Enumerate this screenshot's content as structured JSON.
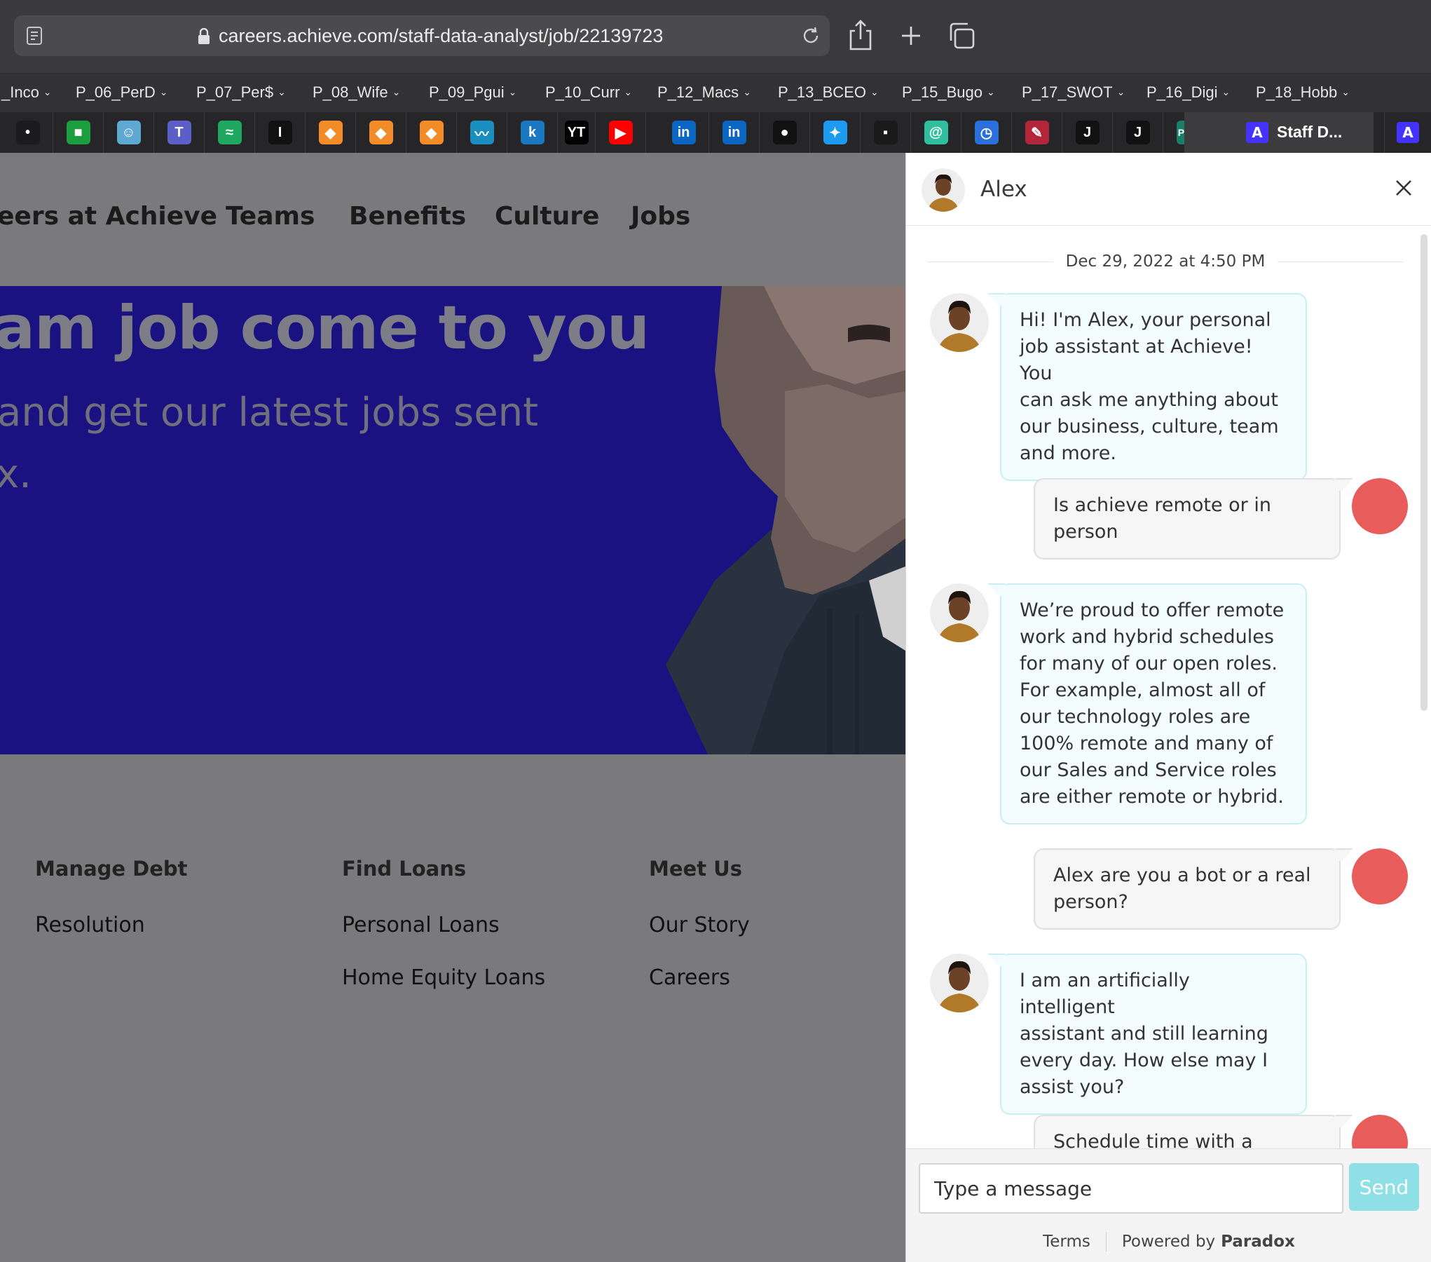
{
  "browser": {
    "url": "careers.achieve.com/staff-data-analyst/job/22139723",
    "bookmarks": [
      {
        "label": "_Inco"
      },
      {
        "label": "P_06_PerD"
      },
      {
        "label": "P_07_Per$"
      },
      {
        "label": "P_08_Wife"
      },
      {
        "label": "P_09_Pgui"
      },
      {
        "label": "P_10_Curr"
      },
      {
        "label": "P_12_Macs"
      },
      {
        "label": "P_13_BCEO"
      },
      {
        "label": "P_15_Bugo"
      },
      {
        "label": "P_17_SWOT"
      },
      {
        "label": "P_16_Digi"
      },
      {
        "label": "P_18_Hobb"
      }
    ],
    "pinned_tabs": [
      {
        "icon": "dots-app-icon",
        "glyph": "•",
        "color": "#1c1c1e"
      },
      {
        "icon": "green-square-icon",
        "glyph": "■",
        "color": "#1b9e3e"
      },
      {
        "icon": "reddit-icon",
        "glyph": "☺",
        "color": "#5fa8d3"
      },
      {
        "icon": "teams-icon",
        "glyph": "T",
        "color": "#5b5fc7"
      },
      {
        "icon": "zapier-like-icon",
        "glyph": "≈",
        "color": "#1fa85f"
      },
      {
        "icon": "i-letter-icon",
        "glyph": "I",
        "color": "#111111"
      },
      {
        "icon": "orange-box-icon",
        "glyph": "◆",
        "color": "#f28c28"
      },
      {
        "icon": "orange-box-icon",
        "glyph": "◆",
        "color": "#f28c28"
      },
      {
        "icon": "orange-box-icon",
        "glyph": "◆",
        "color": "#f28c28"
      },
      {
        "icon": "chart-line-icon",
        "glyph": "〰",
        "color": "#1a8fbf"
      },
      {
        "icon": "k-letter-icon",
        "glyph": "k",
        "color": "#1a78c2"
      },
      {
        "icon": "ycombinator-icon",
        "glyph": "YT",
        "color": "#000000"
      },
      {
        "icon": "youtube-icon",
        "glyph": "▶",
        "color": "#ff0000"
      },
      {
        "icon": "linkedin-icon",
        "glyph": "in",
        "color": "#0a66c2"
      },
      {
        "icon": "linkedin-icon",
        "glyph": "in",
        "color": "#0a66c2"
      },
      {
        "icon": "github-icon",
        "glyph": "●",
        "color": "#111111"
      },
      {
        "icon": "twitter-icon",
        "glyph": "✦",
        "color": "#1d9bf0"
      },
      {
        "icon": "video-app-icon",
        "glyph": "▪",
        "color": "#1a1a1a"
      },
      {
        "icon": "spiral-icon",
        "glyph": "@",
        "color": "#2fbf9f"
      },
      {
        "icon": "clock-icon",
        "glyph": "◷",
        "color": "#2a6fdb"
      },
      {
        "icon": "signature-icon",
        "glyph": "✎",
        "color": "#b3263a"
      },
      {
        "icon": "j-letter-icon",
        "glyph": "J",
        "color": "#111111"
      },
      {
        "icon": "j-letter-icon",
        "glyph": "J",
        "color": "#111111"
      },
      {
        "icon": "prn-icon",
        "glyph": "PRN",
        "color": "#1a7f6a"
      }
    ],
    "active_tab": {
      "label": "Staff D...",
      "icon": "achieve-tab-icon"
    }
  },
  "site": {
    "nav": [
      "eers at Achieve",
      "Teams",
      "Benefits",
      "Culture",
      "Jobs"
    ],
    "hero": {
      "title": "am job come to you",
      "subtitle_line1": "and get our latest jobs sent",
      "subtitle_line2": "x."
    },
    "footer": {
      "columns": [
        {
          "heading": "Manage Debt",
          "links": [
            "Resolution"
          ]
        },
        {
          "heading": "Find Loans",
          "links": [
            "Personal Loans",
            "Home Equity Loans"
          ]
        },
        {
          "heading": "Meet Us",
          "links": [
            "Our Story",
            "Careers"
          ]
        }
      ]
    }
  },
  "chat": {
    "agent_name": "Alex",
    "date": "Dec 29, 2022 at 4:50 PM",
    "messages": [
      {
        "from": "bot",
        "text": "Hi! I'm Alex, your personal\njob assistant at Achieve! You\ncan ask me anything about\nour business, culture, team\nand more."
      },
      {
        "from": "user",
        "text": "Is achieve remote or in\nperson"
      },
      {
        "from": "bot",
        "text": "We’re proud to offer remote\nwork and hybrid schedules\nfor many of our open roles.\nFor example, almost all of\nour technology roles are\n100% remote and many of\nour Sales and Service roles\nare either remote or hybrid."
      },
      {
        "from": "user",
        "text": "Alex are you a bot or a real\nperson?"
      },
      {
        "from": "bot",
        "text": "I am an artificially intelligent\nassistant and still learning\nevery day. How else may I\nassist you?"
      },
      {
        "from": "user",
        "text": "Schedule time with a"
      }
    ],
    "input_placeholder": "Type a message",
    "send_label": "Send",
    "footer_terms": "Terms",
    "footer_powered": "Powered by",
    "footer_brand": "Paradox",
    "colors": {
      "user_avatar": "#e85c5c",
      "send_button": "#8ee0e6",
      "bot_bubble": "#f3fdfe"
    }
  }
}
